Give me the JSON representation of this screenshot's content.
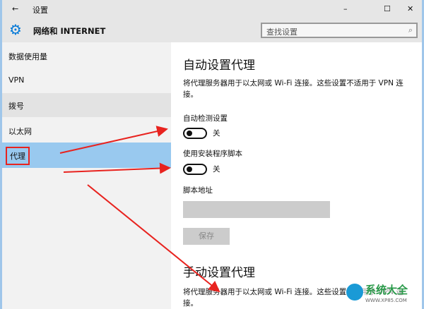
{
  "window": {
    "title": "设置",
    "back_icon": "←",
    "minimize": "–",
    "maximize": "☐",
    "close": "✕"
  },
  "header": {
    "title": "网络和 INTERNET",
    "search_placeholder": "查找设置"
  },
  "sidebar": {
    "items": [
      {
        "label": "数据使用量"
      },
      {
        "label": "VPN"
      },
      {
        "label": "拨号"
      },
      {
        "label": "以太网"
      },
      {
        "label": "代理"
      }
    ]
  },
  "main": {
    "auto_title": "自动设置代理",
    "auto_desc": "将代理服务器用于以太网或 Wi-Fi 连接。这些设置不适用于 VPN 连接。",
    "auto_detect_label": "自动检测设置",
    "auto_detect_state": "关",
    "script_label": "使用安装程序脚本",
    "script_state": "关",
    "script_address_label": "脚本地址",
    "script_address_value": "",
    "save_label": "保存",
    "manual_title": "手动设置代理",
    "manual_desc": "将代理服务器用于以太网或 Wi-Fi 连接。这些设置不适用于 VPN 连接。"
  },
  "watermark": {
    "text": "系统大全",
    "url": "WWW.XP85.COM"
  },
  "colors": {
    "selected": "#99c9ef",
    "accent": "#0078d7",
    "arrow": "#e8231f"
  }
}
